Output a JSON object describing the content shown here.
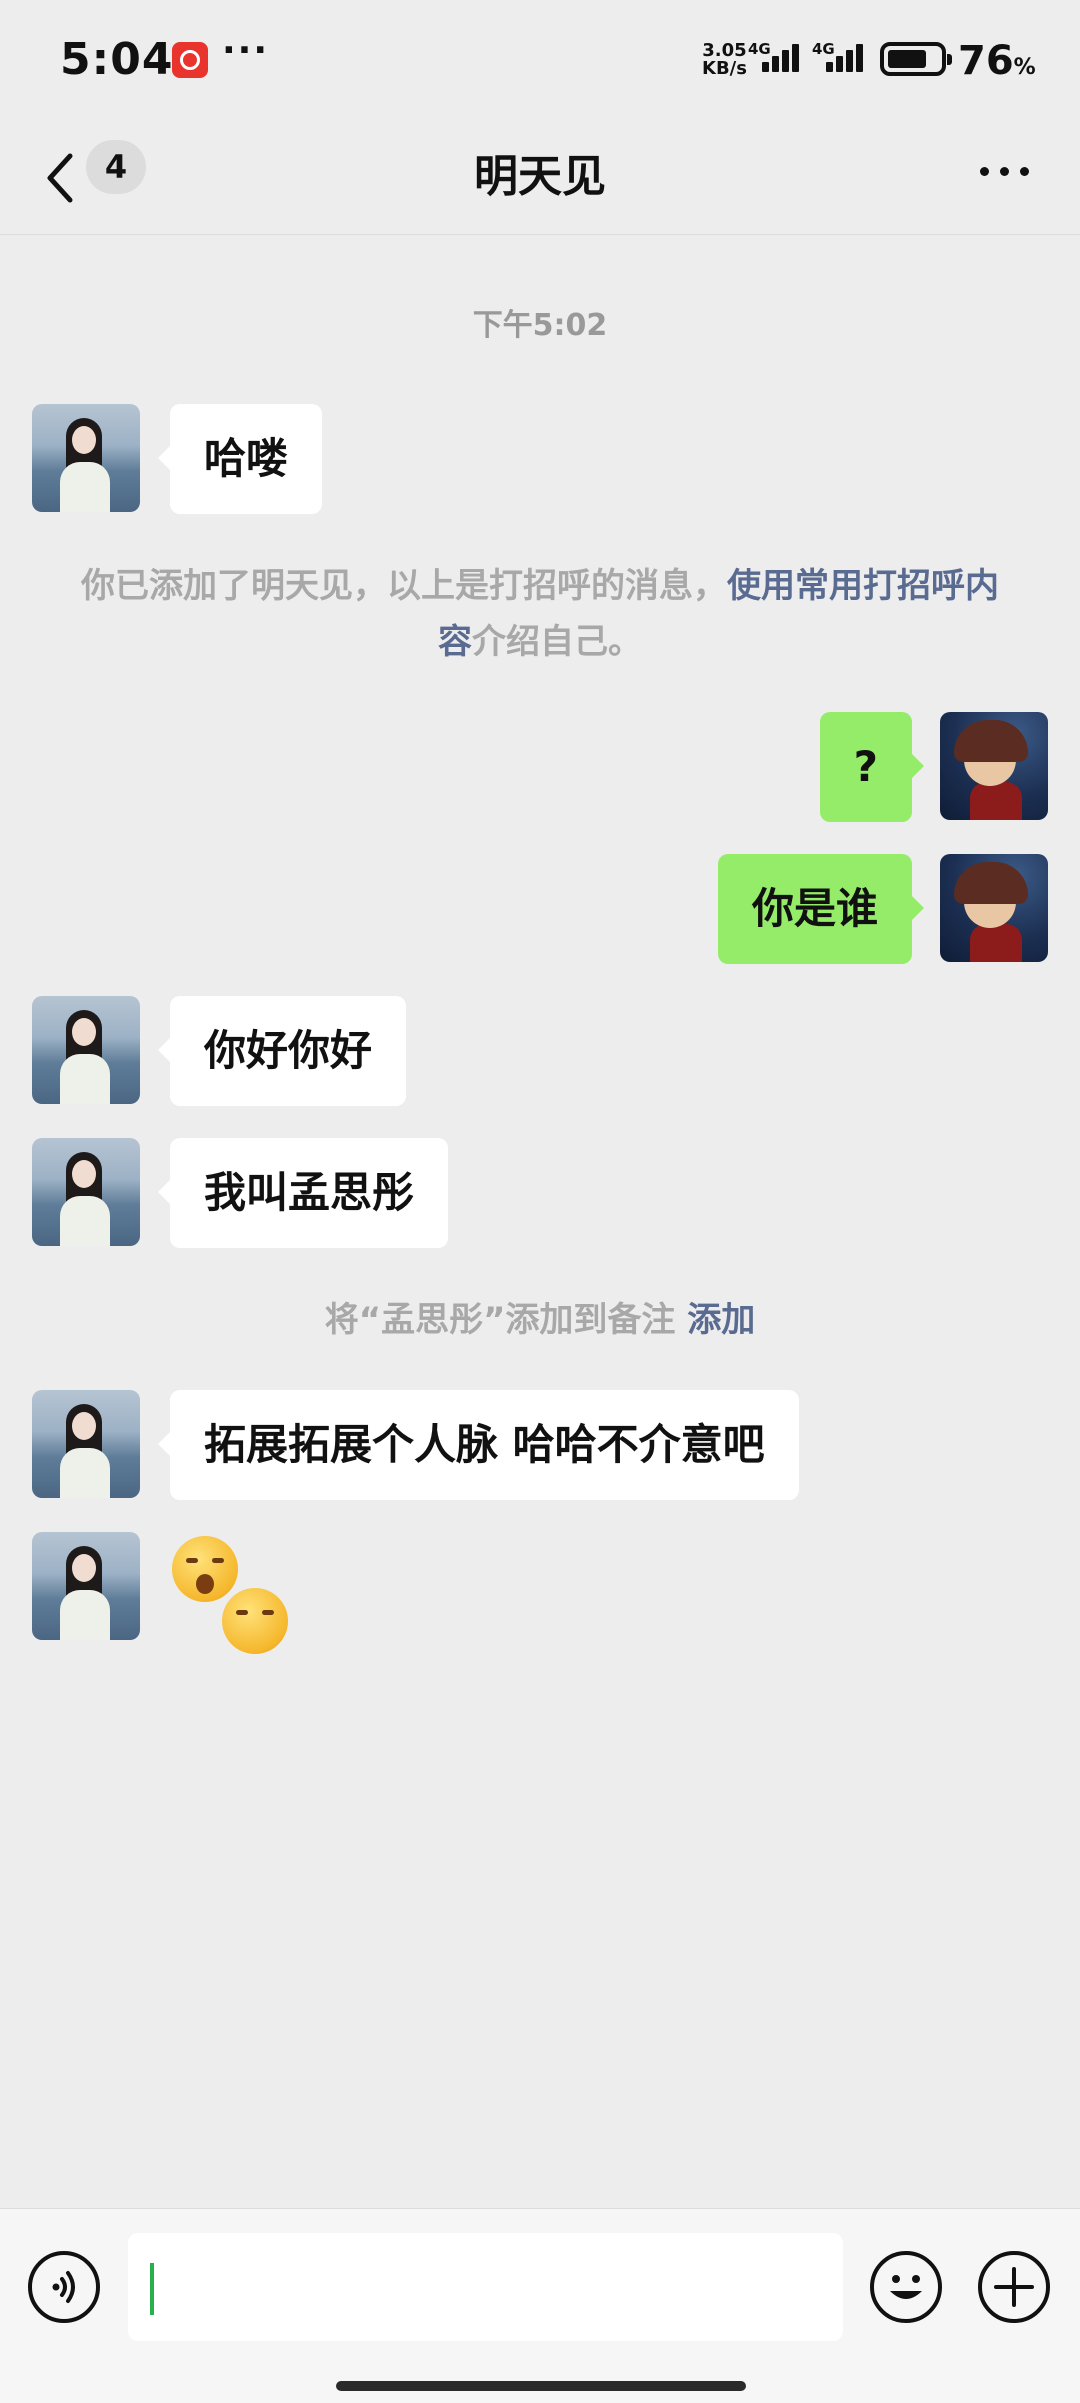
{
  "status_bar": {
    "time": "5:04",
    "more": "···",
    "net_speed_value": "3.05",
    "net_speed_unit": "KB/s",
    "signal_1_tag": "4G",
    "signal_2_tag": "4G",
    "battery_level": 0.76,
    "battery_value": "76",
    "battery_unit": "%"
  },
  "nav": {
    "unread_count": "4",
    "title": "明天见"
  },
  "chat": {
    "timestamp": "下午5:02",
    "messages": [
      {
        "from": "them",
        "text": "哈喽"
      },
      {
        "from": "me",
        "text": "?"
      },
      {
        "from": "me",
        "text": "你是谁"
      },
      {
        "from": "them",
        "text": "你好你好"
      },
      {
        "from": "them",
        "text": "我叫孟思彤"
      },
      {
        "from": "them",
        "text": "拓展拓展个人脉 哈哈不介意吧"
      }
    ],
    "greeting_note": {
      "prefix": "你已添加了明天见，以上是打招呼的消息，",
      "link": "使用常用打招呼内容",
      "suffix": "介绍自己。"
    },
    "remark_note": {
      "text": "将“孟思彤”添加到备注",
      "link": "添加"
    },
    "sticker_emojis": [
      "yawn-emoji",
      "sly-smile-emoji"
    ]
  },
  "input_bar": {
    "voice_icon": "voice-icon",
    "emoji_icon": "smile-icon",
    "plus_icon": "plus-icon",
    "input_value": ""
  },
  "colors": {
    "background": "#ededed",
    "outgoing_bubble": "#95ec69",
    "incoming_bubble": "#ffffff",
    "link": "#5a6b91",
    "caret": "#27b04c"
  }
}
